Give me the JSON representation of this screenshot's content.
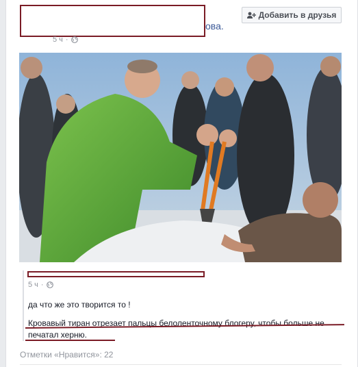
{
  "post": {
    "author_tail": "ова.",
    "time": "5 ч",
    "separator": "·",
    "add_friend_label": "Добавить в друзья"
  },
  "shared": {
    "time": "5 ч",
    "separator": "·",
    "text": "да что же это творится то !",
    "caption": "Кровавый тиран отрезает пальцы белоленточному блогеру, чтобы больше не печатал херню."
  },
  "likes": {
    "label": "Отметки «Нравится»: 22"
  },
  "colors": {
    "redaction": "#7a1b25",
    "link": "#3b5998",
    "jacket": "#5ea83a"
  },
  "icons": [
    "add-friend-icon",
    "globe-icon"
  ]
}
